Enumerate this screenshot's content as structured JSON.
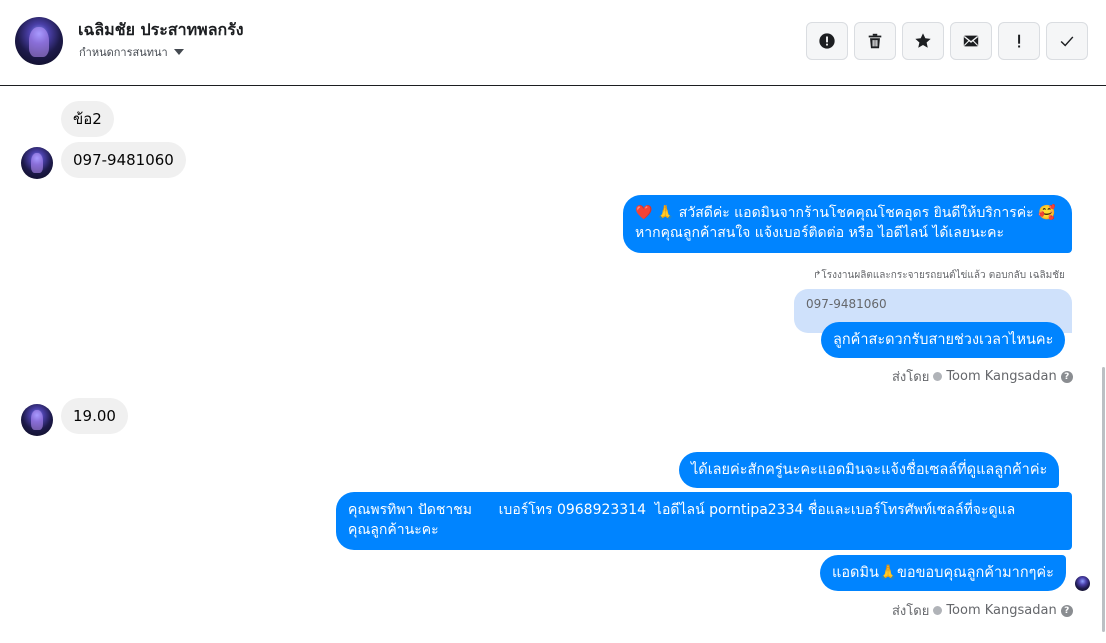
{
  "header": {
    "contact_name": "เฉลิมชัย ประสาทพลกรัง",
    "subtitle": "กำหนดการสนทนา",
    "toolbar": [
      {
        "name": "report-icon",
        "label": "!"
      },
      {
        "name": "trash-icon"
      },
      {
        "name": "star-icon"
      },
      {
        "name": "mail-icon"
      },
      {
        "name": "exclamation-icon",
        "label": "!"
      },
      {
        "name": "check-icon"
      }
    ]
  },
  "messages": {
    "m1": "ข้อ2",
    "m2": "097-9481060",
    "m3_line1": "สวัสดีค่ะ แอดมินจากร้านโชคคุณโชคอุดร ยินดีให้บริการค่ะ",
    "m3_line2": "หากคุณลูกค้าสนใจ แจ้งเบอร์ติดต่อ หรือ ไอดีไลน์ ได้เลยนะคะ",
    "reply_note": "โรงงานผลิตและกระจายรถยนต์ไข่แล้ว ตอบกลับ เฉลิมชัย",
    "quoted": "097-9481060",
    "m4": "ลูกค้าสะดวกรับสายช่วงเวลาไหนคะ",
    "m5": "19.00",
    "m6": "ได้เลยค่ะสักครู่นะคะแอดมินจะแจ้งชื่อเซลล์ที่ดูแลลูกค้าค่ะ",
    "m7_line1": "คุณพรทิพา ปัดชาชม      เบอร์โทร 0968923314  ไอดีไลน์ porntipa2334 ชื่อและเบอร์โทรศัพท์เซลล์ที่จะดูแล",
    "m7_line2": "คุณลูกค้านะคะ",
    "m8_prefix": "แอดมิน",
    "m8_suffix": "ขอขอบคุณลูกค้ามากๆค่ะ"
  },
  "meta": {
    "sent_by_label": "ส่งโดย",
    "sender": "Toom Kangsadan"
  },
  "colors": {
    "outgoing": "#0084ff",
    "incoming": "#f0f0f0",
    "quoted": "#cfe1fb"
  }
}
